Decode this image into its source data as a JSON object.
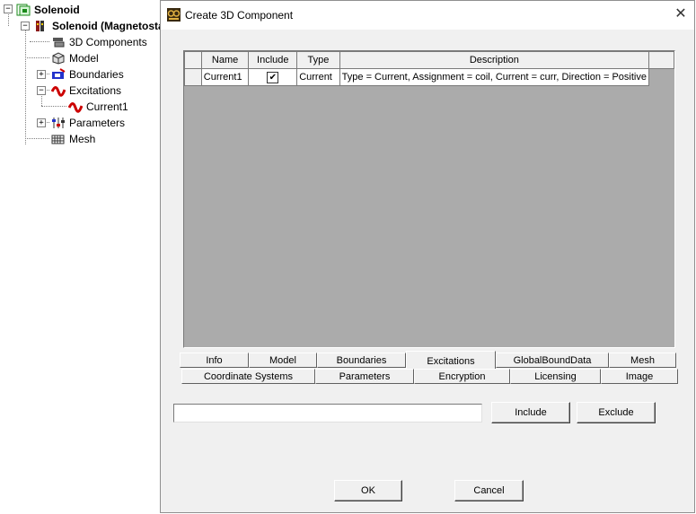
{
  "tree": {
    "root": "Solenoid",
    "design": "Solenoid (Magnetosta",
    "children": [
      "3D Components",
      "Model",
      "Boundaries",
      "Excitations",
      "Current1",
      "Parameters",
      "Mesh"
    ]
  },
  "dialog": {
    "title": "Create 3D Component",
    "close_glyph": "✕",
    "table": {
      "headers": [
        "Name",
        "Include",
        "Type",
        "Description"
      ],
      "rows": [
        {
          "name": "Current1",
          "include": "✔",
          "type": "Current",
          "description": "Type = Current, Assignment = coil, Current = curr, Direction = Positive"
        }
      ]
    },
    "tabs_row1": [
      "Info",
      "Model",
      "Boundaries",
      "Excitations",
      "GlobalBoundData",
      "Mesh"
    ],
    "tabs_row2": [
      "Coordinate Systems",
      "Parameters",
      "Encryption",
      "Licensing",
      "Image"
    ],
    "selected_tab": "Excitations",
    "text_value": "",
    "include_button": "Include",
    "exclude_button": "Exclude",
    "ok_button": "OK",
    "cancel_button": "Cancel"
  }
}
